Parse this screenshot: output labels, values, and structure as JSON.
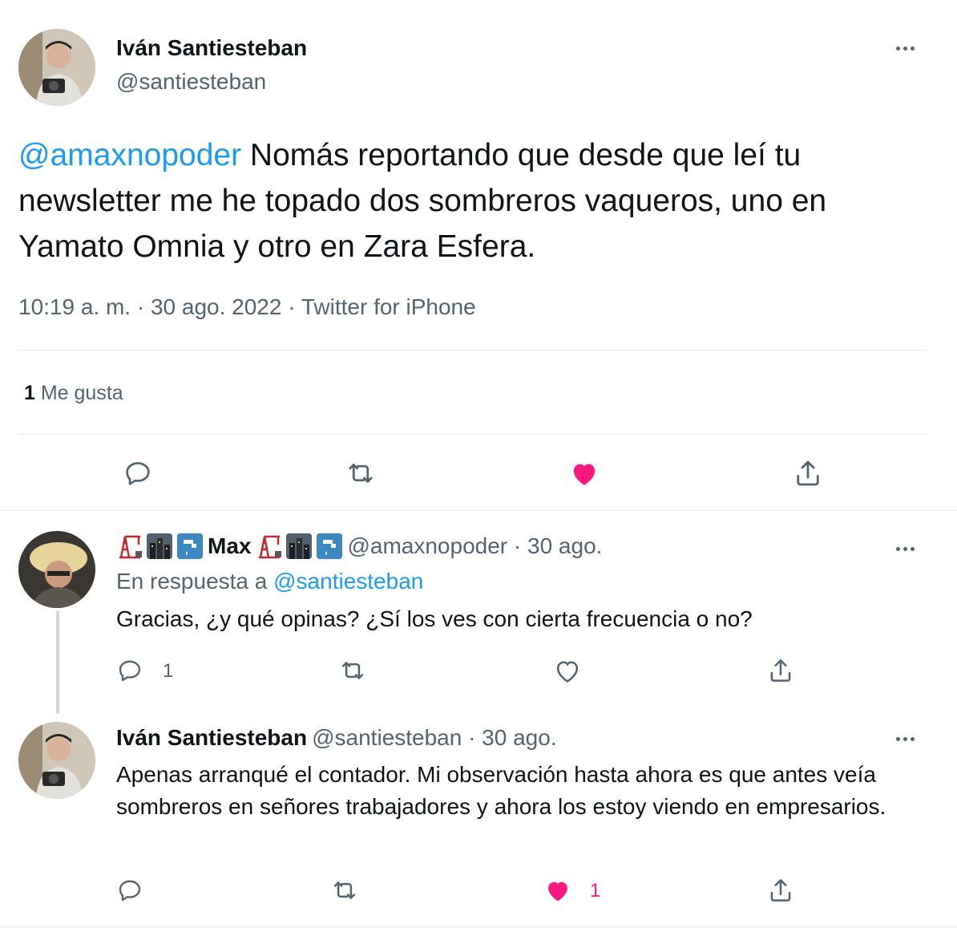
{
  "main_tweet": {
    "author_name": "Iván Santiesteban",
    "author_handle": "@santiesteban",
    "avatar_icon": "avatar-photo",
    "mention": "@amaxnopoder",
    "text": " Nomás reportando que desde que leí tu newsletter me he topado dos sombreros vaqueros, uno en Yamato Omnia y otro en Zara Esfera.",
    "timestamp": "10:19 a. m. · 30 ago. 2022 · Twitter for iPhone",
    "likes_count": "1",
    "likes_label": " Me gusta",
    "liked": true,
    "actions": [
      "reply-icon",
      "retweet-icon",
      "like-icon",
      "share-icon"
    ]
  },
  "replies": [
    {
      "display_name": "Max",
      "name_emojis": [
        "building-construction-emoji",
        "cityscape-emoji",
        "potable-water-emoji"
      ],
      "handle_time": "@amaxnopoder · 30 ago.",
      "in_reply_prefix": "En respuesta a ",
      "in_reply_handle": "@santiesteban",
      "text": "Gracias, ¿y qué opinas? ¿Sí los ves con cierta frecuencia o no?",
      "reply_count": "1",
      "like_count": "",
      "liked": false
    },
    {
      "display_name": "Iván Santiesteban",
      "handle_time": "@santiesteban · 30 ago.",
      "text": "Apenas arranqué el contador. Mi observación hasta ahora es que antes veía sombreros en señores trabajadores y ahora los estoy viendo en empresarios.",
      "reply_count": "",
      "like_count": "1",
      "liked": true
    }
  ],
  "colors": {
    "accent": "#1d9bf0",
    "like": "#f91880",
    "muted": "#536471",
    "text": "#0f1419",
    "border": "#e6ecf0"
  }
}
